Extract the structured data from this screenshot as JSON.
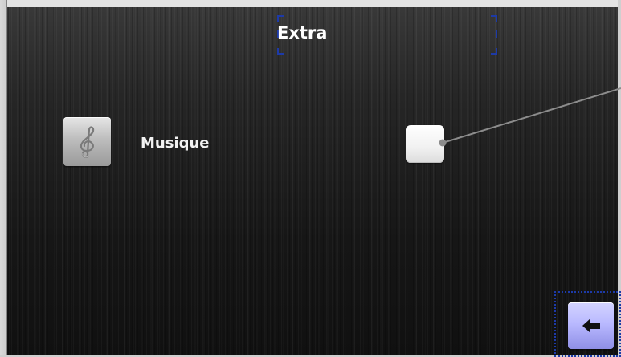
{
  "header": {
    "title": "Extra"
  },
  "settings": {
    "items": [
      {
        "icon": "treble-clef-icon",
        "label": "Musique",
        "checked": false
      }
    ]
  },
  "footer": {
    "back_icon": "arrow-left-icon"
  },
  "colors": {
    "accent_frame": "#1d3aa8",
    "back_button": "#b9b9ff",
    "text": "#ffffff"
  }
}
